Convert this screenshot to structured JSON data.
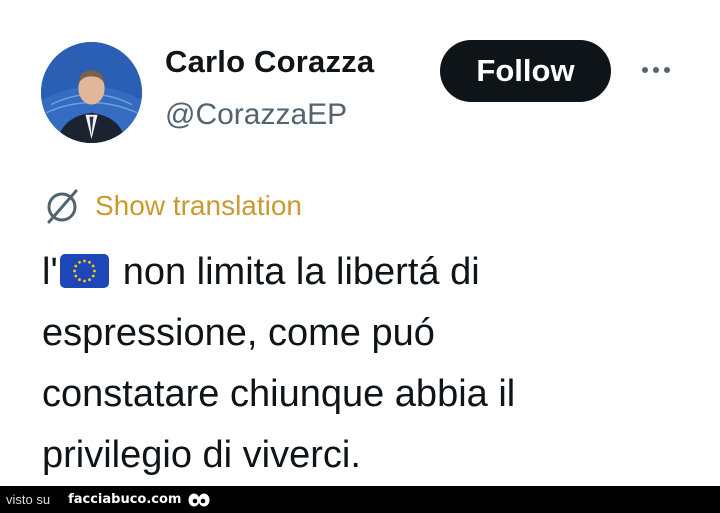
{
  "profile": {
    "display_name": "Carlo Corazza",
    "handle": "@CorazzaEP",
    "follow_label": "Follow"
  },
  "icons": {
    "translate": "globe-slash-icon",
    "more": "more-horizontal-icon",
    "flag": "eu-flag-icon"
  },
  "translation": {
    "label": "Show translation",
    "color": "#c99a2e"
  },
  "tweet": {
    "line1_prefix": "l'",
    "line1_rest": "non limita la libertá di",
    "line2": "espressione, come puó",
    "line3": "constatare chiunque abbia il",
    "line4": "privilegio di viverci."
  },
  "footer": {
    "prefix": "visto su",
    "site": "facciabuco.com"
  },
  "colors": {
    "text": "#0f1419",
    "secondary": "#536471",
    "follow_bg": "#0f1419",
    "eu_blue": "#1d47b8",
    "eu_star": "#ffcc00"
  }
}
